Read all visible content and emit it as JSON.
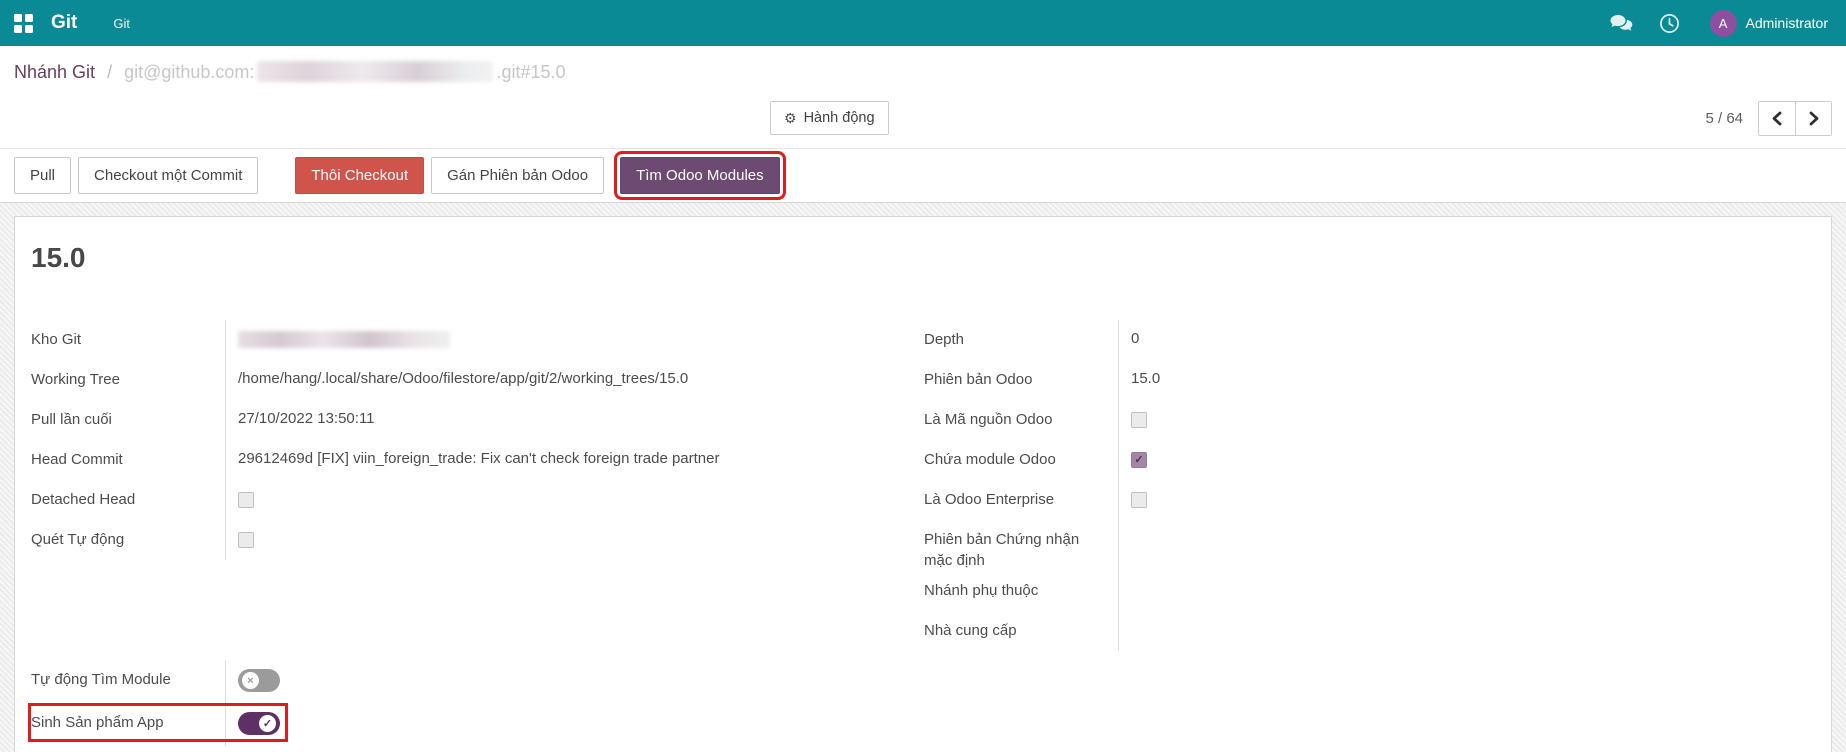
{
  "topbar": {
    "brand": "Git",
    "menu": "Git",
    "user": "Administrator",
    "avatar_initial": "A",
    "icons": [
      "apps-grid-icon",
      "chat-icon",
      "clock-activities-icon"
    ]
  },
  "breadcrumb": {
    "parent": "Nhánh Git",
    "separator": "/",
    "repo_prefix": "git@github.com:",
    "repo_hidden": "blurred-repository-name",
    "repo_suffix": ".git#15.0"
  },
  "control": {
    "action_label": "Hành động",
    "action_icon": "gear-icon",
    "pager_value": "5 / 64",
    "pager_prev": "previous-record",
    "pager_next": "next-record"
  },
  "statusbar": {
    "buttons": [
      {
        "label": "Pull",
        "style": "default"
      },
      {
        "label": "Checkout một Commit",
        "style": "default"
      },
      {
        "label": "Thôi Checkout",
        "style": "danger"
      },
      {
        "label": "Gán Phiên bản Odoo",
        "style": "default"
      },
      {
        "label": "Tìm Odoo Modules",
        "style": "primary",
        "annotated": true
      }
    ]
  },
  "form": {
    "title": "15.0",
    "left_fields": [
      {
        "label": "Kho Git",
        "type": "blur"
      },
      {
        "label": "Working Tree",
        "type": "text",
        "value": "/home/hang/.local/share/Odoo/filestore/app/git/2/working_trees/15.0"
      },
      {
        "label": "Pull lần cuối",
        "type": "text",
        "value": "27/10/2022 13:50:11"
      },
      {
        "label": "Head Commit",
        "type": "text",
        "value": "29612469d [FIX] viin_foreign_trade: Fix can't check foreign trade partner"
      },
      {
        "label": "Detached Head",
        "type": "checkbox",
        "checked": false
      },
      {
        "label": "Quét Tự động",
        "type": "checkbox",
        "checked": false
      }
    ],
    "right_fields": [
      {
        "label": "Depth",
        "type": "text",
        "value": "0"
      },
      {
        "label": "Phiên bản Odoo",
        "type": "text",
        "value": "15.0"
      },
      {
        "label": "Là Mã nguồn Odoo",
        "type": "checkbox",
        "checked": false
      },
      {
        "label": "Chứa module Odoo",
        "type": "checkbox",
        "checked": true
      },
      {
        "label": "Là Odoo Enterprise",
        "type": "checkbox",
        "checked": false
      },
      {
        "label": "Phiên bản Chứng nhận mặc định",
        "type": "empty",
        "value": ""
      },
      {
        "label": "Nhánh phụ thuộc",
        "type": "empty",
        "value": ""
      },
      {
        "label": "Nhà cung cấp",
        "type": "empty",
        "value": ""
      }
    ],
    "toggles": [
      {
        "label": "Tự động Tìm Module",
        "on": false
      },
      {
        "label": "Sinh Sản phẩm App",
        "on": true,
        "annotated": true
      }
    ]
  },
  "colors": {
    "topbar": "#0a8a94",
    "primary_button": "#6d4a71",
    "danger_button": "#d0544b",
    "toggle_on": "#5e3066",
    "checkbox_checked": "#a385a4",
    "breadcrumb_link": "#65415c",
    "avatar": "#8e4fa0",
    "annotation": "#df1e1c"
  }
}
